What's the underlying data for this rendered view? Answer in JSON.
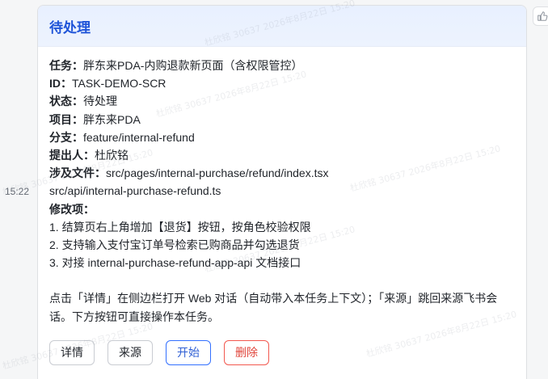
{
  "message": {
    "time": "15:22",
    "card": {
      "title": "待处理",
      "fields": [
        {
          "key": "任务",
          "value": "胖东来PDA-内购退款新页面（含权限管控）"
        },
        {
          "key": "ID",
          "value": "TASK-DEMO-SCR"
        },
        {
          "key": "状态",
          "value": "待处理"
        },
        {
          "key": "项目",
          "value": "胖东来PDA"
        },
        {
          "key": "分支",
          "value": "feature/internal-refund"
        },
        {
          "key": "提出人",
          "value": "杜欣铭"
        },
        {
          "key": "涉及文件",
          "value": "src/pages/internal-purchase/refund/index.tsx"
        }
      ],
      "file_extra": "src/api/internal-purchase-refund.ts",
      "changes_label": "修改项：",
      "changes": [
        "1. 结算页右上角增加【退货】按钮，按角色校验权限",
        "2. 支持输入支付宝订单号检索已购商品并勾选退货",
        "3. 对接 internal-purchase-refund-app-api 文档接口"
      ],
      "hint_line1": "点击「详情」在侧边栏打开 Web 对话（自动带入本任务上下文）；「来源」跳回来源飞书会",
      "hint_line2": "话。下方按钮可直接操作本任务。",
      "buttons": {
        "detail": "详情",
        "source": "来源",
        "start": "开始",
        "delete": "删除"
      }
    }
  },
  "watermark": {
    "text": "杜欣铭 30637 2026年8月22日 15:20"
  },
  "colors": {
    "accent": "#3370ff",
    "title": "#1f54d8",
    "danger": "#f2584f",
    "header_bg": "#e8f0ff"
  },
  "icons": {
    "side_tool": "thumbs-up-icon"
  }
}
